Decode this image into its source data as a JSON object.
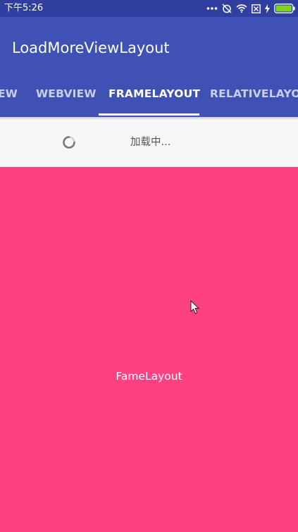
{
  "status_bar": {
    "time": "下午5:26",
    "icons": [
      "more-dots-icon",
      "alarm-off-icon",
      "wifi-icon",
      "sim-card-icon",
      "charging-bolt-icon",
      "battery-icon"
    ]
  },
  "app_bar": {
    "title": "LoadMoreViewLayout",
    "tabs": [
      {
        "label": "EW",
        "selected": false
      },
      {
        "label": "WEBVIEW",
        "selected": false
      },
      {
        "label": "FRAMELAYOUT",
        "selected": true
      },
      {
        "label": "RELATIVELAYOUT",
        "selected": false
      }
    ]
  },
  "loading": {
    "text": "加载中..."
  },
  "content": {
    "label": "FameLayout"
  },
  "colors": {
    "status_bar": "#303f9f",
    "primary": "#3f51b5",
    "accent": "#ff4081",
    "battery": "#7ed321"
  }
}
